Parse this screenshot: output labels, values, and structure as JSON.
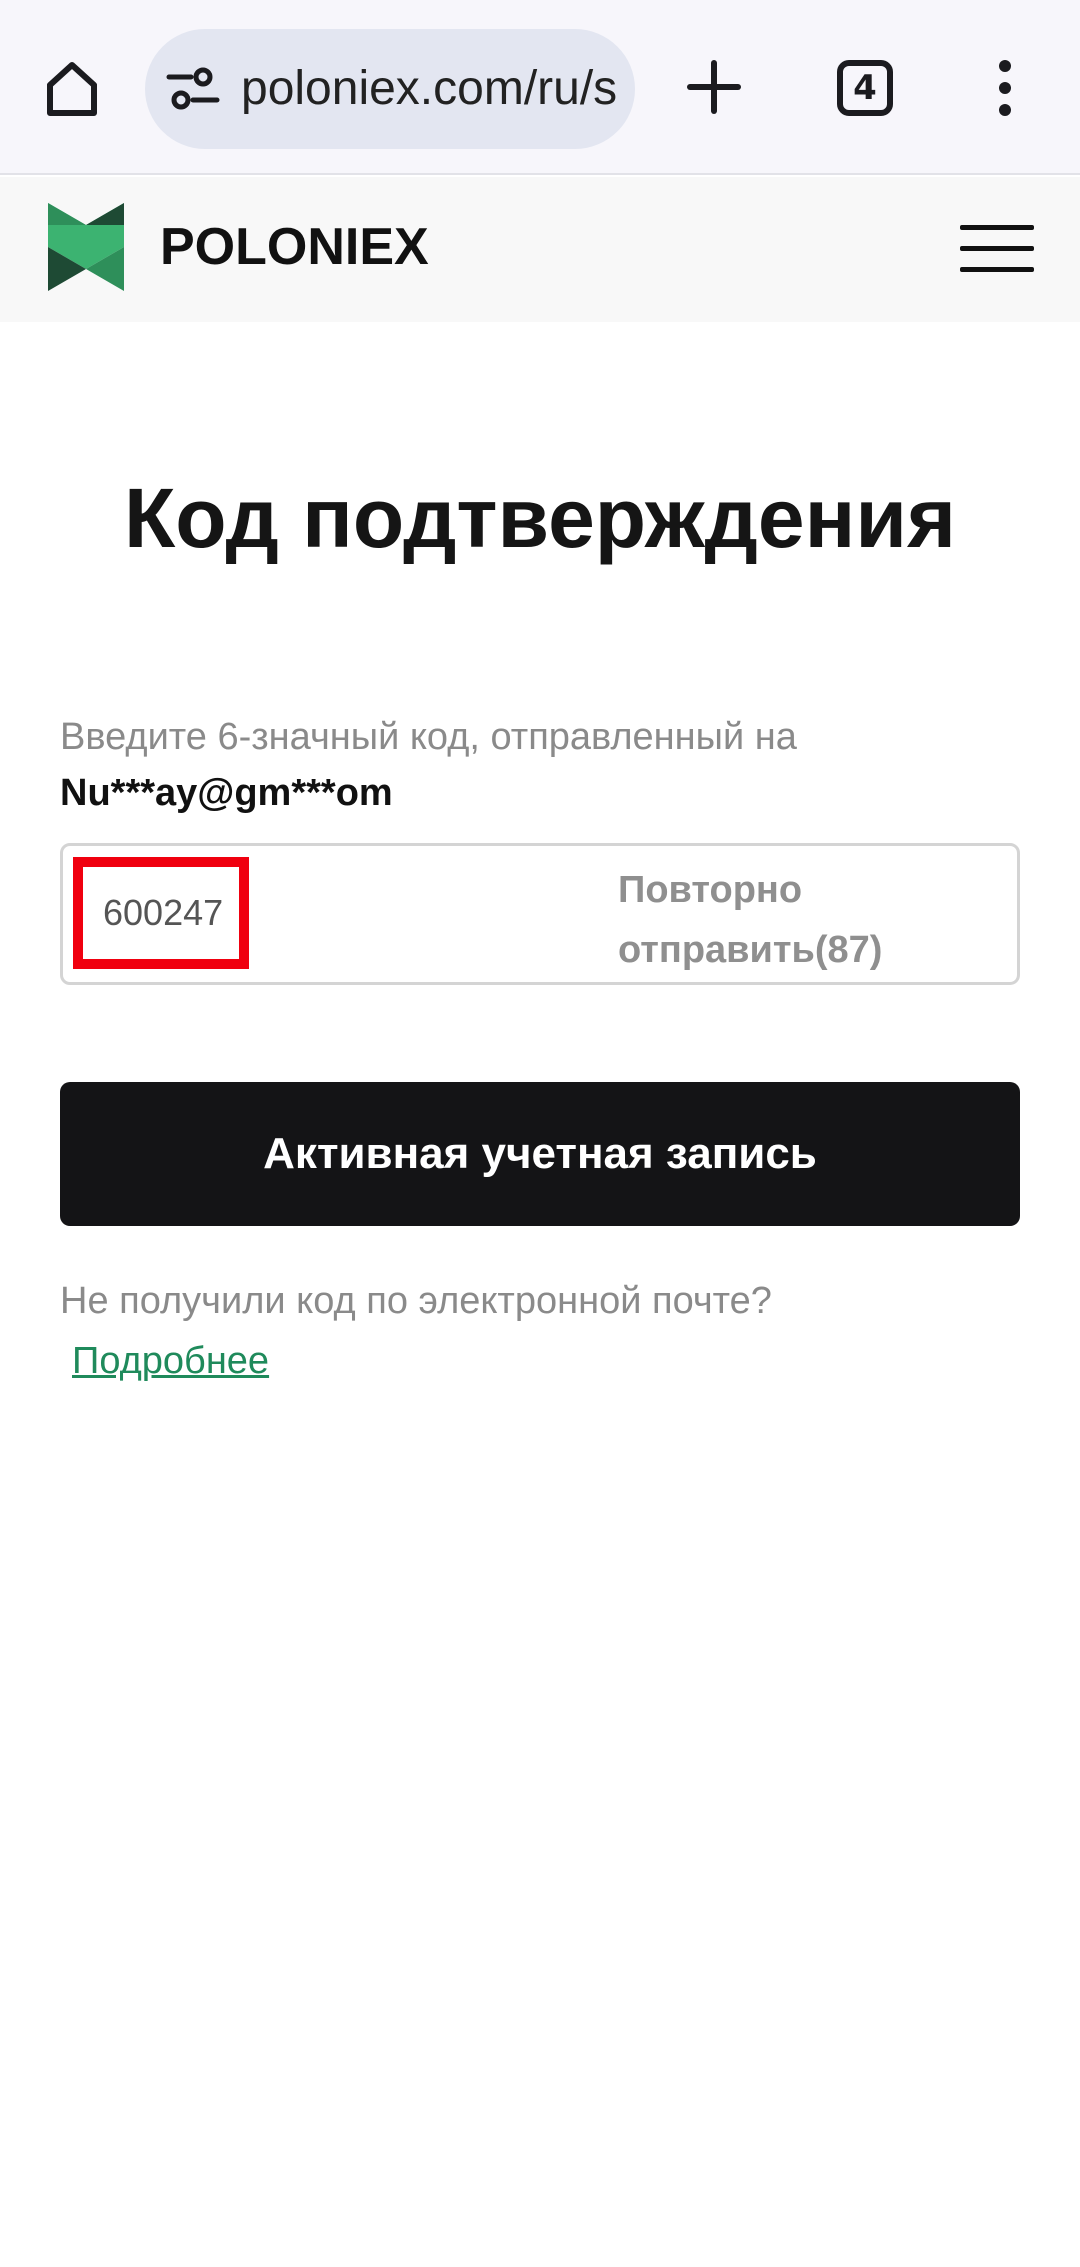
{
  "browser": {
    "url": "poloniex.com/ru/s",
    "tab_count": "4",
    "icons": {
      "home": "home-icon",
      "site_settings": "tune-icon",
      "new_tab": "plus-icon",
      "tabs": "tab-switcher-icon",
      "menu": "more-vert-icon"
    }
  },
  "site": {
    "brand": "POLONIEX",
    "brand_colors": {
      "dark": "#1e4a34",
      "light": "#3cb371"
    },
    "menu_icon": "hamburger-icon"
  },
  "verification": {
    "title": "Код подтверждения",
    "instruction": "Введите 6-значный код, отправленный на",
    "email": "Nu***ay@gm***om",
    "code_value": "600247",
    "resend_label": "Повторно отправить(87)",
    "submit_label": "Активная учетная запись",
    "no_code_text": "Не получили код по электронной почте?",
    "details_link": "Подробнее"
  },
  "colors": {
    "highlight_box": "#f0000f",
    "button_bg": "#141416",
    "link": "#1f8a5b"
  }
}
